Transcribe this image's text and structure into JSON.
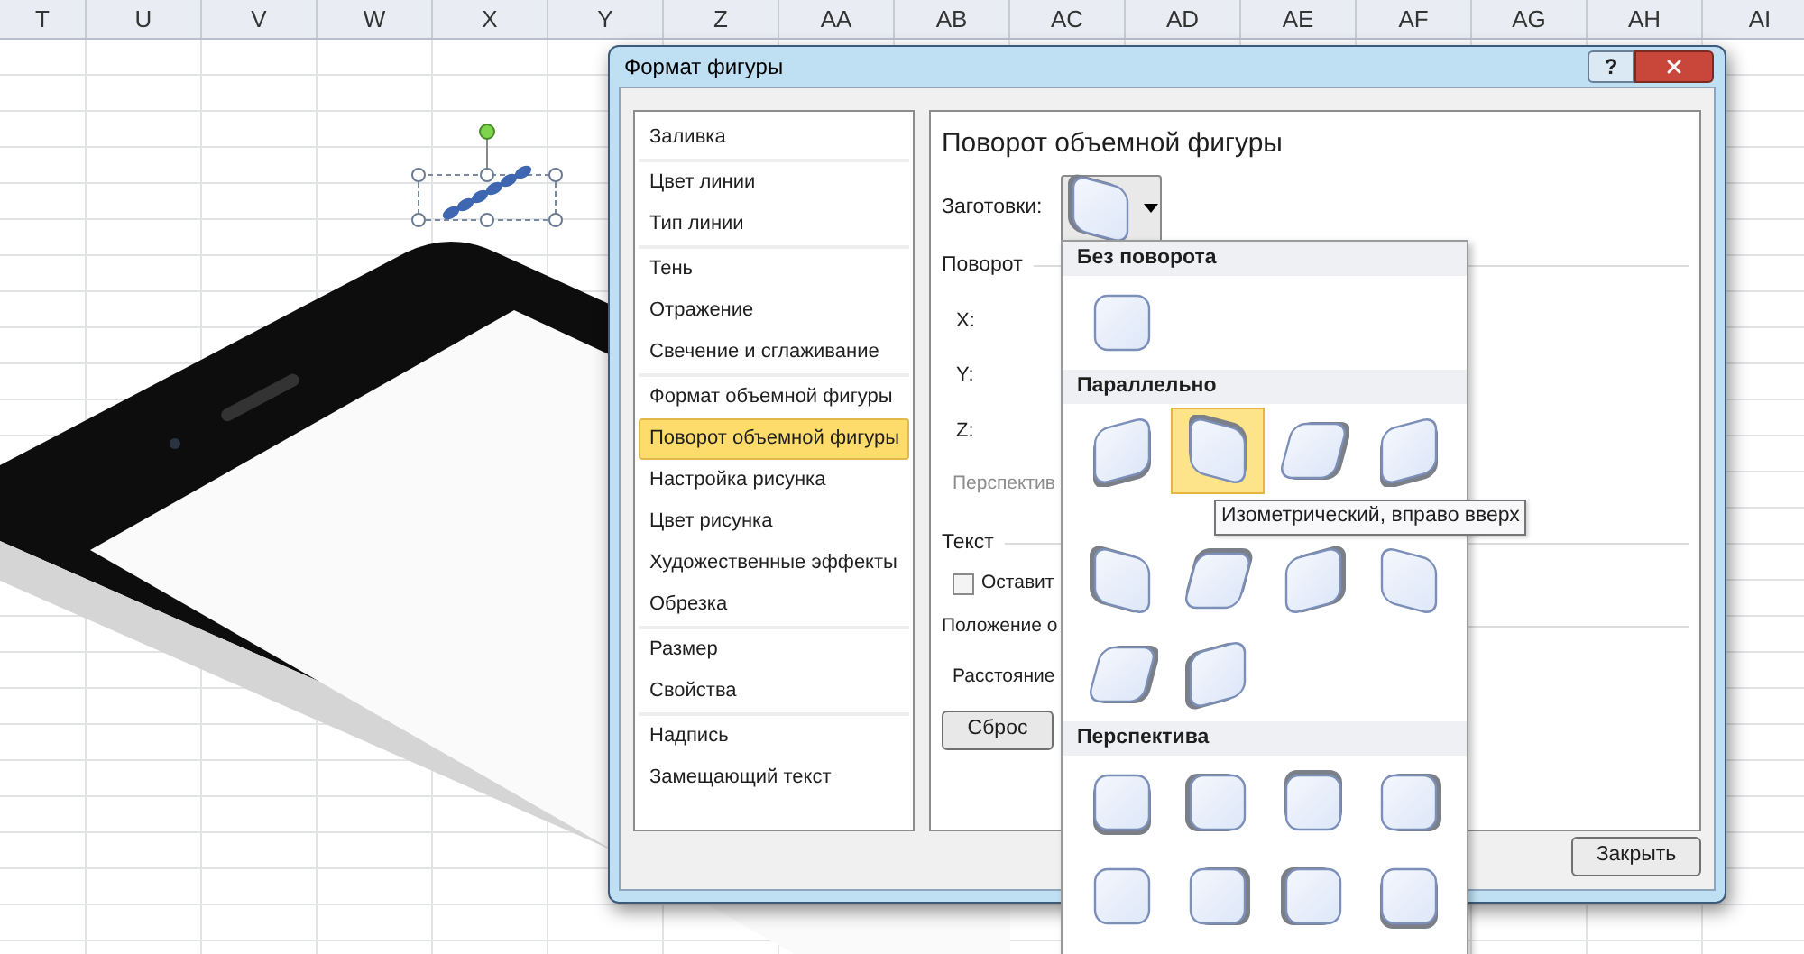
{
  "sheet": {
    "columns": [
      "T",
      "U",
      "V",
      "W",
      "X",
      "Y",
      "Z",
      "AA",
      "AB",
      "AC",
      "AD",
      "AE",
      "AF",
      "AG",
      "AH",
      "AI"
    ]
  },
  "dialog": {
    "title": "Формат фигуры",
    "help": "?"
  },
  "sidebar": {
    "groups": [
      {
        "items": [
          {
            "label": "Заливка",
            "selected": false
          }
        ]
      },
      {
        "items": [
          {
            "label": "Цвет линии",
            "selected": false
          },
          {
            "label": "Тип линии",
            "selected": false
          }
        ]
      },
      {
        "items": [
          {
            "label": "Тень",
            "selected": false
          },
          {
            "label": "Отражение",
            "selected": false
          },
          {
            "label": "Свечение и сглаживание",
            "selected": false
          }
        ]
      },
      {
        "items": [
          {
            "label": "Формат объемной фигуры",
            "selected": false
          },
          {
            "label": "Поворот объемной фигуры",
            "selected": true
          },
          {
            "label": "Настройка рисунка",
            "selected": false
          },
          {
            "label": "Цвет рисунка",
            "selected": false
          },
          {
            "label": "Художественные эффекты",
            "selected": false
          },
          {
            "label": "Обрезка",
            "selected": false
          }
        ]
      },
      {
        "items": [
          {
            "label": "Размер",
            "selected": false
          },
          {
            "label": "Свойства",
            "selected": false
          }
        ]
      },
      {
        "items": [
          {
            "label": "Надпись",
            "selected": false
          },
          {
            "label": "Замещающий текст",
            "selected": false
          }
        ]
      }
    ]
  },
  "panel": {
    "title": "Поворот объемной фигуры",
    "presets_label": "Заготовки:",
    "rotation": {
      "heading": "Поворот",
      "fields": [
        "X:",
        "Y:",
        "Z:"
      ],
      "perspective": {
        "label": "Перспектив",
        "disabled": true
      }
    },
    "text": {
      "heading": "Текст",
      "checkbox": {
        "label": "Оставит",
        "checked": false
      }
    },
    "position": {
      "heading": "Положение о",
      "distance": "Расстояние"
    },
    "reset": "Сброс"
  },
  "presets_popup": {
    "sections": [
      {
        "title": "Без поворота",
        "items": [
          {
            "selected": false
          }
        ]
      },
      {
        "title": "Параллельно",
        "items": [
          {
            "selected": false
          },
          {
            "selected": true
          },
          {
            "selected": false
          },
          {
            "selected": false
          },
          {
            "selected": false
          },
          {
            "selected": false
          },
          {
            "selected": false
          },
          {
            "selected": false
          },
          {
            "selected": false
          },
          {
            "selected": false
          }
        ]
      },
      {
        "title": "Перспектива",
        "items": [
          {
            "selected": false
          },
          {
            "selected": false
          },
          {
            "selected": false
          },
          {
            "selected": false
          },
          {
            "selected": false
          },
          {
            "selected": false
          },
          {
            "selected": false
          },
          {
            "selected": false
          }
        ]
      }
    ]
  },
  "tooltip": "Изометрический, вправо вверх",
  "close_button": "Закрыть"
}
